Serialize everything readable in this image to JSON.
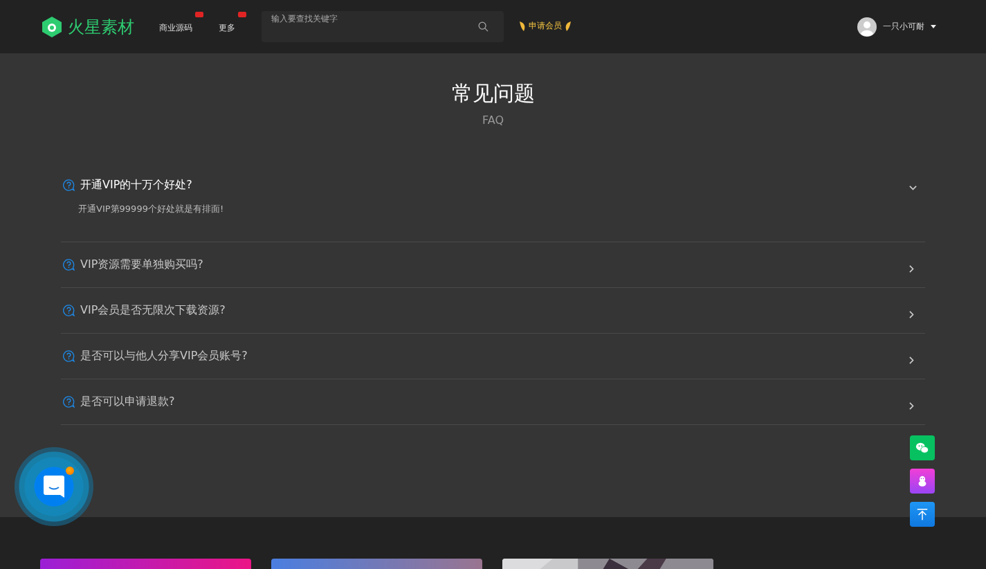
{
  "header": {
    "logo": "火星素材",
    "nav": [
      {
        "label": "商业源码",
        "badge": true
      },
      {
        "label": "更多",
        "badge": true
      }
    ],
    "search": {
      "placeholder": "输入要查找关键字"
    },
    "vip_link": "申请会员",
    "user": {
      "name": "一只小可耐"
    }
  },
  "faq": {
    "title": "常见问题",
    "subtitle": "FAQ",
    "items": [
      {
        "question": "开通VIP的十万个好处?",
        "answer": "开通VIP第99999个好处就是有排面!",
        "expanded": true
      },
      {
        "question": "VIP资源需要单独购买吗?",
        "expanded": false
      },
      {
        "question": "VIP会员是否无限次下载资源?",
        "expanded": false
      },
      {
        "question": "是否可以与他人分享VIP会员账号?",
        "expanded": false
      },
      {
        "question": "是否可以申请退款?",
        "expanded": false
      }
    ]
  },
  "chat_widget": {
    "unread": true
  },
  "side_buttons": [
    {
      "kind": "wechat"
    },
    {
      "kind": "qq"
    },
    {
      "kind": "top"
    }
  ],
  "cards": [
    {
      "kind": "gradient",
      "color": "#9b1fd6"
    },
    {
      "kind": "gradient",
      "color": "#4a7ee0"
    },
    {
      "kind": "picture"
    }
  ]
}
